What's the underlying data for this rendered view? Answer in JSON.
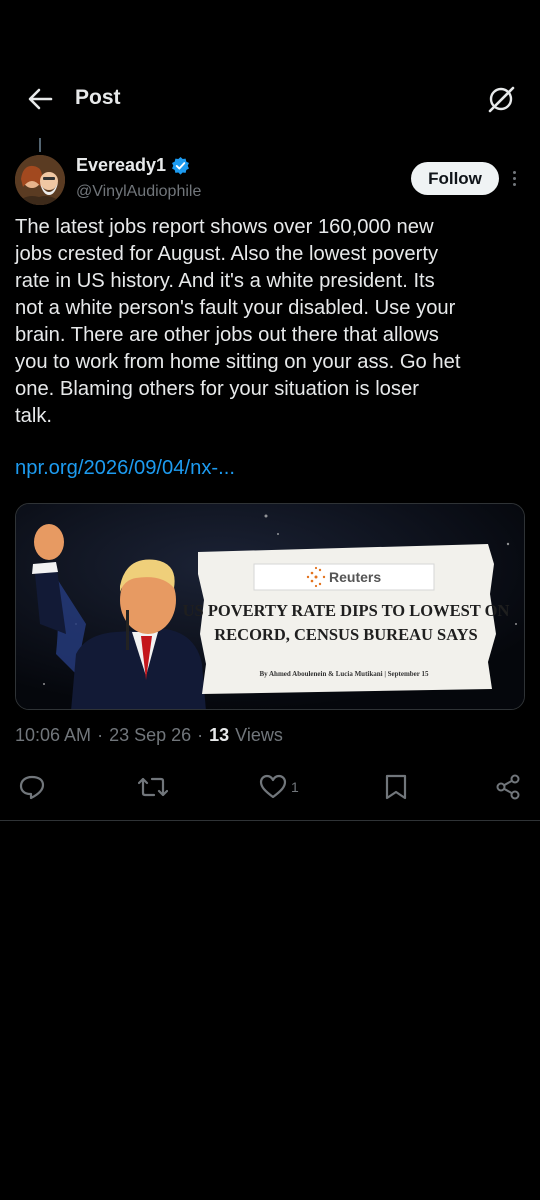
{
  "header": {
    "title": "Post",
    "back_icon": "arrow-left-icon",
    "grok_icon": "grok-icon"
  },
  "author": {
    "display_name": "Eveready1",
    "handle": "@VinylAudiophile",
    "verified": true,
    "verified_color": "#1d9bf0",
    "follow_label": "Follow"
  },
  "tweet": {
    "text": "The latest jobs report shows over 160,000 new\njobs crested for August. Also the lowest poverty\nrate in US history. And it's a white president. Its\nnot a white person's fault your disabled. Use your\nbrain. There are other jobs out there that allows\nyou to work from home sitting on your ass. Go het\none. Blaming others for your situation is loser\ntalk.",
    "link": "npr.org/2026/09/04/nx-..."
  },
  "media": {
    "logo_text": "Reuters",
    "headline_line1": "US POVERTY RATE DIPS TO LOWEST ON",
    "headline_line2": "RECORD, CENSUS BUREAU SAYS",
    "byline": "By Ahmed Aboulenein & Lucia Mutikani | September 15"
  },
  "meta": {
    "time": "10:06 AM",
    "sep1": "·",
    "date": "23 Sep 26",
    "sep2": "·",
    "views_count": "13",
    "views_label": "Views"
  },
  "actions": {
    "like_count": "1",
    "icons": [
      "reply-icon",
      "repost-icon",
      "like-icon",
      "bookmark-icon",
      "share-icon"
    ]
  },
  "colors": {
    "background": "#000000",
    "text": "#e7e9ea",
    "muted": "#71767b",
    "link": "#1d9bf0"
  }
}
